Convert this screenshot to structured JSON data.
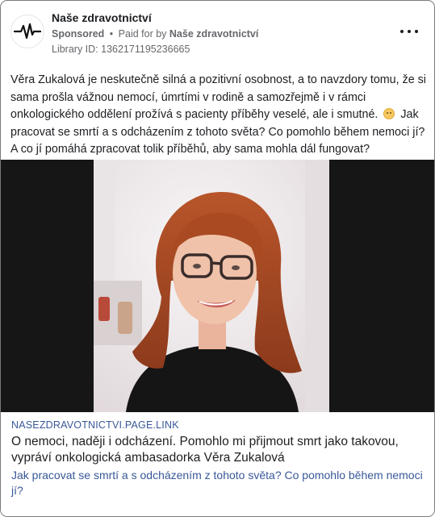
{
  "header": {
    "page_name": "Naše zdravotnictví",
    "sponsored": "Sponsored",
    "paid_for_prefix": "Paid for by",
    "paid_for_name": "Naše zdravotnictví",
    "separator": "•",
    "library_id": "Library ID: 1362171195236665",
    "avatar_icon": "heartbeat-icon",
    "more_icon": "more-options-icon"
  },
  "post": {
    "text_before_emoji": "Věra Zukalová je neskutečně silná a pozitivní osobnost, a to navzdory tomu, že si sama prošla vážnou nemocí, úmrtími v rodině a samozřejmě i v rámci onkologického oddělení prožívá s pacienty příběhy veselé, ale i smutné.",
    "emoji": "flushed-face-emoji",
    "text_after_emoji": "Jak pracovat se smrtí a s odcházením z tohoto světa? Co pomohlo během nemoci jí? A co jí pomáhá zpracovat tolik příběhů, aby sama mohla dál fungovat?"
  },
  "link": {
    "domain": "NASEZDRAVOTNICTVI.PAGE.LINK",
    "title": "O nemoci, naději i odcházení. Pomohlo mi přijmout smrt jako takovou, vypráví onkologická ambasadorka Věra Zukalová",
    "description": "Jak pracovat se smrtí a s odcházením z tohoto světa? Co pomohlo během nemoci jí?"
  },
  "colors": {
    "link_blue": "#385898",
    "meta_gray": "#65676b",
    "text": "#1c1e21",
    "media_background": "#161616"
  }
}
